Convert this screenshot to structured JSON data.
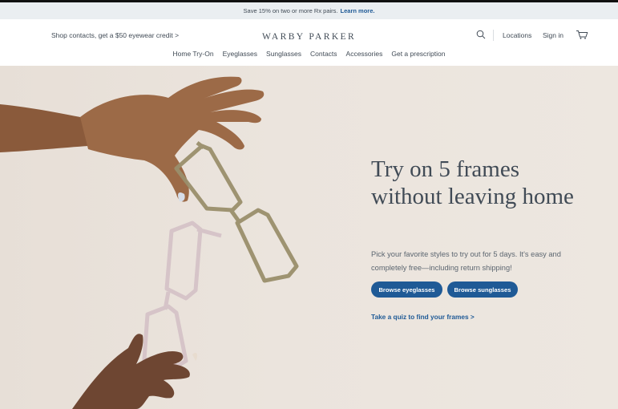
{
  "promo": {
    "text": "Save 15% on two or more Rx pairs.",
    "link": "Learn more."
  },
  "header": {
    "shop_contacts": "Shop contacts, get a $50 eyewear credit",
    "shop_chevron": ">",
    "logo": "WARBY PARKER",
    "search_icon": "search-icon",
    "locations": "Locations",
    "sign_in": "Sign in",
    "cart_icon": "cart-icon"
  },
  "nav": {
    "items": [
      "Home Try-On",
      "Eyeglasses",
      "Sunglasses",
      "Contacts",
      "Accessories",
      "Get a prescription"
    ]
  },
  "hero": {
    "headline": "Try on 5 frames without leaving home",
    "subtext": "Pick your favorite styles to try out for 5 days. It's easy and completely free—including return shipping!",
    "button_eyeglasses": "Browse eyeglasses",
    "button_sunglasses": "Browse sunglasses",
    "quiz_link": "Take a quiz to find your frames >",
    "image": "hands-holding-glasses-photo"
  },
  "colors": {
    "brand_blue": "#1f5a96",
    "text": "#414b56",
    "hero_bg": "#ebe4dd",
    "promo_bg": "#eaeef1"
  }
}
